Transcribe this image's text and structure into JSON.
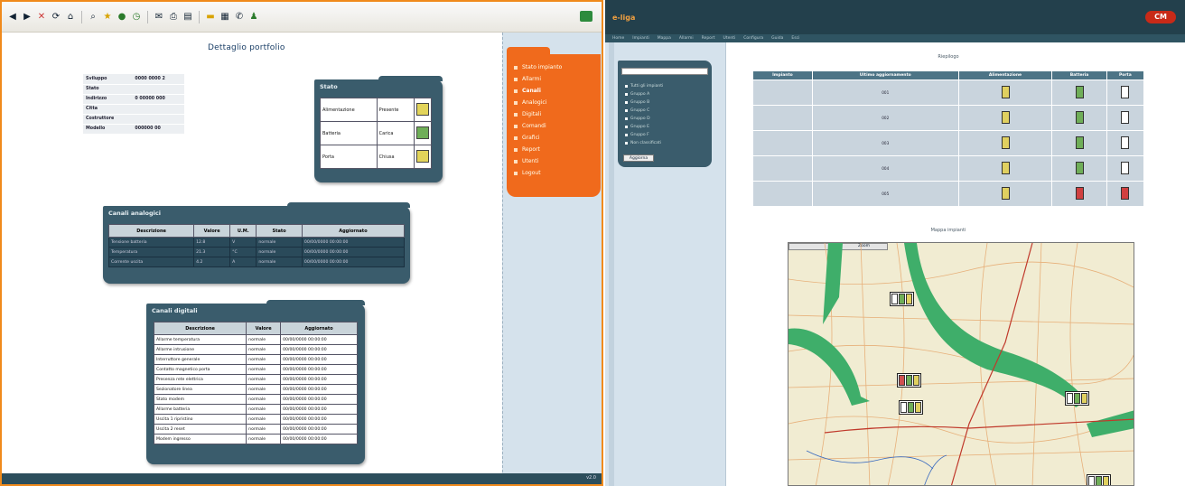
{
  "left": {
    "page_title": "Dettaglio portfolio",
    "info_rows": [
      {
        "label": "Sviluppo",
        "value": "0000 0000 2"
      },
      {
        "label": "Stato",
        "value": ""
      },
      {
        "label": "Indirizzo",
        "value": "0 00000 000"
      },
      {
        "label": "Citta",
        "value": ""
      },
      {
        "label": "Costruttore",
        "value": ""
      },
      {
        "label": "Modello",
        "value": "000000 00"
      }
    ],
    "stato_panel": {
      "title": "Stato",
      "rows": [
        {
          "label": "Alimentazione",
          "status": "Presente"
        },
        {
          "label": "Batteria",
          "status": "Carica"
        },
        {
          "label": "Porta",
          "status": "Chiusa"
        }
      ]
    },
    "analog_panel": {
      "title": "Canali analogici",
      "headers": [
        "Descrizione",
        "Valore",
        "U.M.",
        "Stato",
        "Aggiornato"
      ],
      "rows": [
        [
          "Tensione batteria",
          "12.8",
          "V",
          "normale",
          "00/00/0000 00:00:00"
        ],
        [
          "Temperatura",
          "21.3",
          "°C",
          "normale",
          "00/00/0000 00:00:00"
        ],
        [
          "Corrente uscita",
          "4.2",
          "A",
          "normale",
          "00/00/0000 00:00:00"
        ]
      ]
    },
    "digital_panel": {
      "title": "Canali digitali",
      "headers": [
        "Descrizione",
        "Valore",
        "Aggiornato"
      ],
      "rows": [
        [
          "Allarme temperatura",
          "normale",
          "00/00/0000 00:00:00"
        ],
        [
          "Allarme intrusione",
          "normale",
          "00/00/0000 00:00:00"
        ],
        [
          "Interruttore generale",
          "normale",
          "00/00/0000 00:00:00"
        ],
        [
          "Contatto magnetico porta",
          "normale",
          "00/00/0000 00:00:00"
        ],
        [
          "Presenza rete elettrica",
          "normale",
          "00/00/0000 00:00:00"
        ],
        [
          "Sezionatore linea",
          "normale",
          "00/00/0000 00:00:00"
        ],
        [
          "Stato modem",
          "normale",
          "00/00/0000 00:00:00"
        ],
        [
          "Allarme batteria",
          "normale",
          "00/00/0000 00:00:00"
        ],
        [
          "Uscita 1 ripristino",
          "normale",
          "00/00/0000 00:00:00"
        ],
        [
          "Uscita 2 reset",
          "normale",
          "00/00/0000 00:00:00"
        ],
        [
          "Modem ingresso",
          "normale",
          "00/00/0000 00:00:00"
        ]
      ]
    },
    "menu": [
      "Stato impianto",
      "Allarmi",
      "Canali",
      "Analogici",
      "Digitali",
      "Comandi",
      "Grafici",
      "Report",
      "Utenti",
      "Logout"
    ],
    "menu_selected": 2,
    "footer_text": "v2.0"
  },
  "right": {
    "app_logo": "e-liga",
    "brand": "CM",
    "nav": [
      "Home",
      "Impianti",
      "Mappa",
      "Allarmi",
      "Report",
      "Utenti",
      "Configura",
      "Guida",
      "Esci"
    ],
    "side_list": [
      "Tutti gli impianti",
      "Gruppo A",
      "Gruppo B",
      "Gruppo C",
      "Gruppo D",
      "Gruppo E",
      "Gruppo F",
      "Non classificati"
    ],
    "side_button": "Aggiorna",
    "summary_title": "Riepilogo",
    "summary_headers": [
      "Impianto",
      "Ultimo aggiornamento",
      "Alimentazione",
      "Batteria",
      "Porta"
    ],
    "summary_rows": [
      {
        "id": "001",
        "batt": "g",
        "door": "w"
      },
      {
        "id": "002",
        "batt": "g",
        "door": "w"
      },
      {
        "id": "003",
        "batt": "g",
        "door": "w"
      },
      {
        "id": "004",
        "batt": "g",
        "door": "w"
      },
      {
        "id": "005",
        "batt": "r",
        "door": "r"
      }
    ],
    "map_title": "Mappa impianti",
    "map_toolbar": "Zoom"
  }
}
